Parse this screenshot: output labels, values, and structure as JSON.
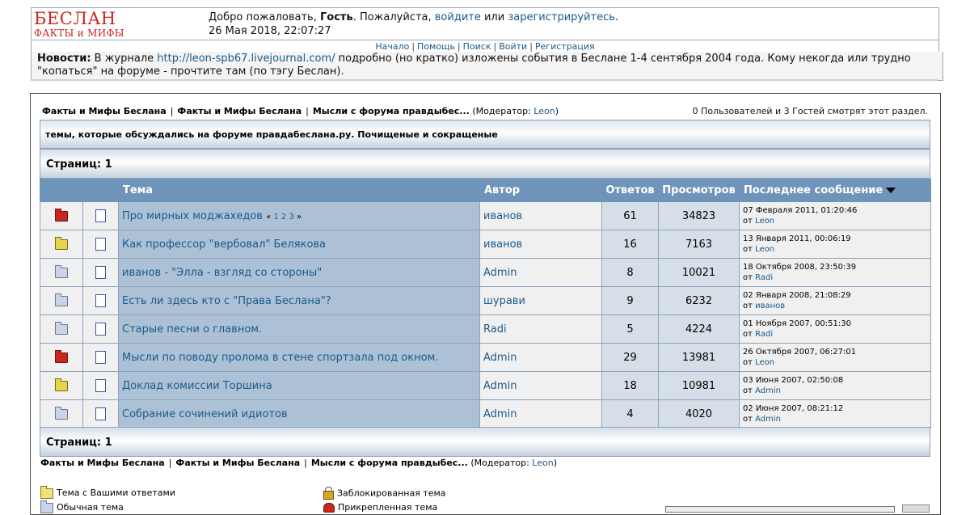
{
  "header": {
    "logo_line1": "БЕСЛАН",
    "logo_line2": "ФАКТЫ и МИФЫ",
    "welcome_prefix": "Добро пожаловать, ",
    "guest": "Гость",
    "welcome_mid": ". Пожалуйста, ",
    "login_link": "войдите",
    "or": " или ",
    "register_link": "зарегистрируйтесь",
    "period": ".",
    "datetime": "26 Мая 2018, 22:07:27"
  },
  "menu": [
    "Начало",
    "Помощь",
    "Поиск",
    "Войти",
    "Регистрация"
  ],
  "news": {
    "label": "Новости:",
    "text_before": " В журнале ",
    "link": "http://leon-spb67.livejournal.com/",
    "text_after": " подробно (но кратко) изложены события в Беслане 1-4 сентября 2004 года. Кому некогда или трудно \"копаться\" на форуме - прочтите там (по тэгу Беслан)."
  },
  "breadcrumb": {
    "items": [
      "Факты и Мифы Беслана",
      "Факты и Мифы Беслана",
      "Мысли с форума правдыбес..."
    ],
    "moderator_prefix": " (Модератор: ",
    "moderator": "Leon",
    "moderator_suffix": ")"
  },
  "viewers": "0 Пользователей и 3 Гостей смотрят этот раздел.",
  "board_description": "темы, которые обсуждались на форуме правдабеслана.ру. Почищеные и сокращеные",
  "pages_label": "Страниц: 1",
  "table": {
    "headers": {
      "subject": "Тема",
      "author": "Автор",
      "replies": "Ответов",
      "views": "Просмотров",
      "last_post": "Последнее сообщение"
    },
    "by_prefix": "от ",
    "rows": [
      {
        "icon": "hot-folder-icon",
        "subject": "Про мирных моджахедов",
        "pages": [
          "1",
          "2",
          "3"
        ],
        "pages_open": "« ",
        "pages_close": " »",
        "author": "иванов",
        "replies": "61",
        "views": "34823",
        "last_date": "07 Февраля 2011, 01:20:46",
        "last_by": "Leon"
      },
      {
        "icon": "sticky-folder-icon",
        "subject": "Как профессор \"вербовал\" Белякова",
        "author": "иванов",
        "replies": "16",
        "views": "7163",
        "last_date": "13 Января 2011, 00:06:19",
        "last_by": "Leon"
      },
      {
        "icon": "folder-icon",
        "subject": "иванов - \"Элла - взгляд со стороны\"",
        "author": "Admin",
        "replies": "8",
        "views": "10021",
        "last_date": "18 Октября 2008, 23:50:39",
        "last_by": "Radi"
      },
      {
        "icon": "folder-icon",
        "subject": "Есть ли здесь кто с \"Права Беслана\"?",
        "author": "шурави",
        "replies": "9",
        "views": "6232",
        "last_date": "02 Января 2008, 21:08:29",
        "last_by": "иванов"
      },
      {
        "icon": "folder-icon",
        "subject": "Старые песни о главном.",
        "author": "Radi",
        "replies": "5",
        "views": "4224",
        "last_date": "01 Ноября 2007, 00:51:30",
        "last_by": "Radi"
      },
      {
        "icon": "hot-folder-icon",
        "subject": "Мысли по поводу пролома в стене спортзала под окном.",
        "author": "Admin",
        "replies": "29",
        "views": "13981",
        "last_date": "26 Октября 2007, 06:27:01",
        "last_by": "Leon"
      },
      {
        "icon": "sticky-folder-icon",
        "subject": "Доклад комиссии Торшина",
        "author": "Admin",
        "replies": "18",
        "views": "10981",
        "last_date": "03 Июня 2007, 02:50:08",
        "last_by": "Admin"
      },
      {
        "icon": "folder-icon",
        "subject": "Собрание сочинений идиотов",
        "author": "Admin",
        "replies": "4",
        "views": "4020",
        "last_date": "02 Июня 2007, 08:21:12",
        "last_by": "Admin"
      }
    ]
  },
  "legend": {
    "my_topic": "Тема с Вашими ответами",
    "normal_topic": "Обычная тема",
    "locked_topic": "Заблокированная тема",
    "sticky_topic": "Прикрепленная тема"
  }
}
